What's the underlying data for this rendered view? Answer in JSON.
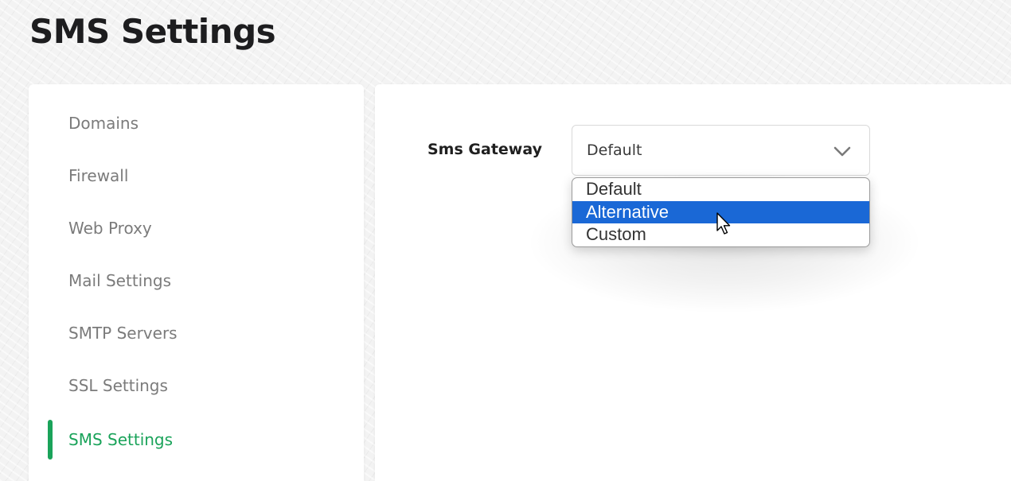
{
  "page": {
    "title": "SMS Settings"
  },
  "sidebar": {
    "items": [
      {
        "label": "Domains",
        "active": false
      },
      {
        "label": "Firewall",
        "active": false
      },
      {
        "label": "Web Proxy",
        "active": false
      },
      {
        "label": "Mail Settings",
        "active": false
      },
      {
        "label": "SMTP Servers",
        "active": false
      },
      {
        "label": "SSL Settings",
        "active": false
      },
      {
        "label": "SMS Settings",
        "active": true
      }
    ]
  },
  "form": {
    "sms_gateway": {
      "label": "Sms Gateway",
      "selected_value": "Default",
      "dropdown_open": true,
      "highlighted_option": "Alternative",
      "options": [
        "Default",
        "Alternative",
        "Custom"
      ]
    }
  },
  "icons": {
    "select_arrow": "chevron-down-icon",
    "pointer": "mouse-cursor-icon"
  },
  "colors": {
    "accent": "#1aa35a",
    "highlight": "#1a68d6"
  }
}
